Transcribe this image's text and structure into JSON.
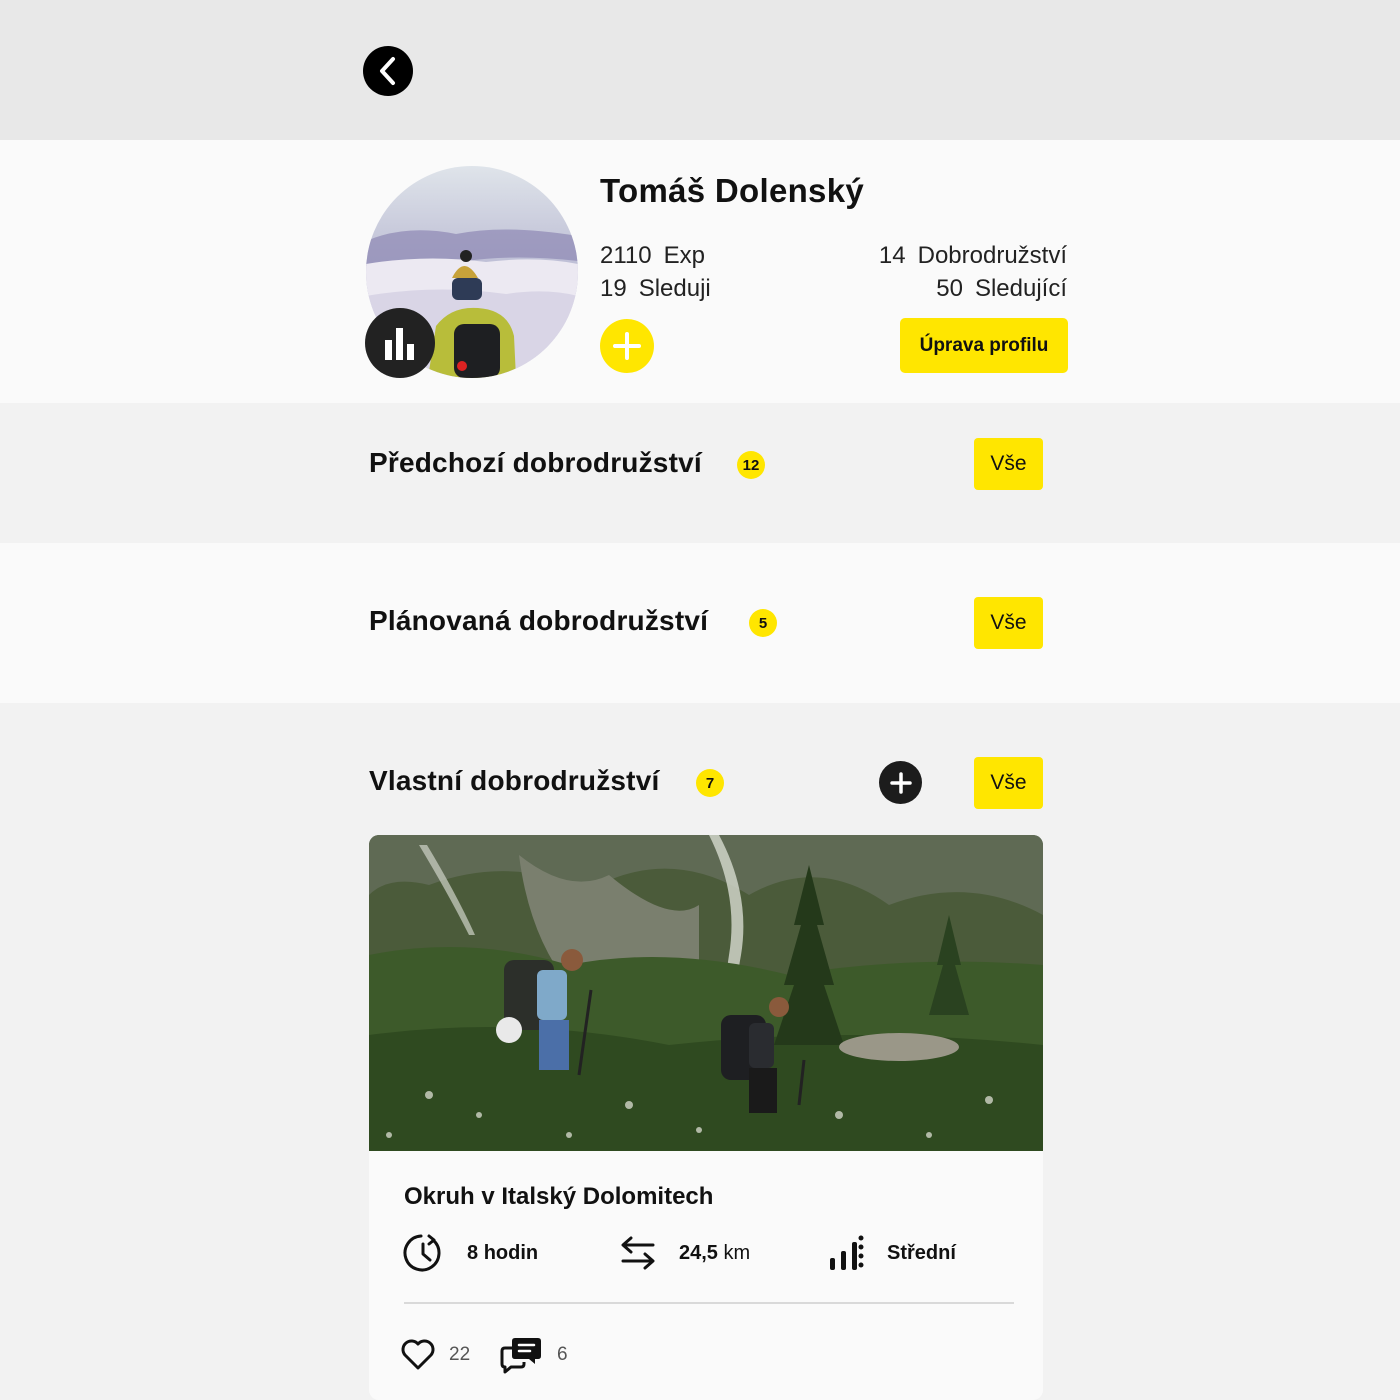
{
  "profile": {
    "name": "Tomáš Dolenský",
    "exp_value": "2110",
    "exp_label": "Exp",
    "following_value": "19",
    "following_label": "Sleduji",
    "adventures_value": "14",
    "adventures_label": "Dobrodružství",
    "followers_value": "50",
    "followers_label": "Sledující",
    "edit_button": "Úprava profilu"
  },
  "sections": {
    "previous": {
      "title": "Předchozí dobrodružství",
      "count": "12",
      "all_button": "Vše"
    },
    "planned": {
      "title": "Plánovaná dobrodružství",
      "count": "5",
      "all_button": "Vše"
    },
    "own": {
      "title": "Vlastní dobrodružství",
      "count": "7",
      "all_button": "Vše"
    }
  },
  "card": {
    "title": "Okruh v Italský Dolomitech",
    "duration_value": "8",
    "duration_unit": "hodin",
    "distance_value": "24,5",
    "distance_unit": "km",
    "difficulty": "Střední",
    "likes": "22",
    "comments": "6"
  },
  "icons": {
    "back": "chevron-left-icon",
    "stats": "bar-chart-icon",
    "add": "plus-icon",
    "duration": "clock-icon",
    "distance": "arrows-swap-icon",
    "difficulty": "difficulty-bars-icon",
    "like": "heart-icon",
    "comment": "chat-bubble-icon"
  },
  "colors": {
    "accent": "#ffe600",
    "dark": "#1c1c1c",
    "background": "#f2f2f2"
  }
}
